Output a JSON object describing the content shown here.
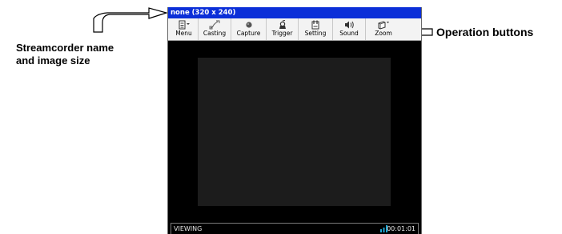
{
  "annotations": {
    "left_line1": "Streamcorder  name",
    "left_line2": "and image size",
    "right": "Operation buttons"
  },
  "window": {
    "title": "none (320 x 240)"
  },
  "toolbar": {
    "buttons": [
      {
        "label": "Menu",
        "icon": "menu-icon"
      },
      {
        "label": "Casting",
        "icon": "casting-icon"
      },
      {
        "label": "Capture",
        "icon": "capture-icon"
      },
      {
        "label": "Trigger",
        "icon": "trigger-icon"
      },
      {
        "label": "Setting",
        "icon": "setting-icon"
      },
      {
        "label": "Sound",
        "icon": "sound-icon"
      },
      {
        "label": "Zoom",
        "icon": "zoom-icon"
      }
    ]
  },
  "status": {
    "mode": "VIEWING",
    "time": "00:01:01"
  },
  "colors": {
    "titlebar": "#0b2fd8",
    "signal": "#1ea8d6"
  }
}
